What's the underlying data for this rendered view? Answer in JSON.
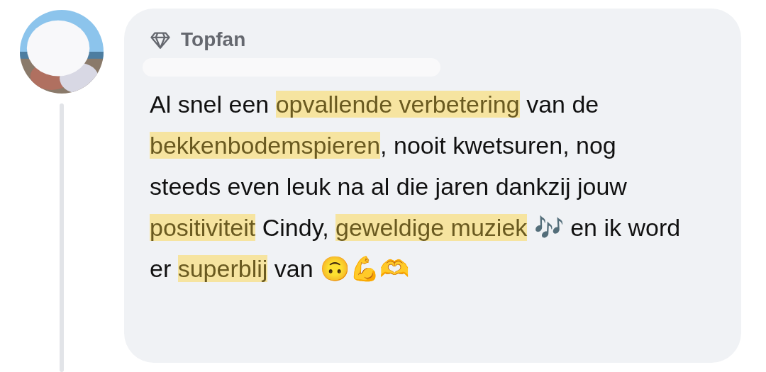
{
  "comment": {
    "badge": "Topfan",
    "segments": [
      {
        "text": "Al snel een ",
        "highlighted": false
      },
      {
        "text": "opvallende verbetering",
        "highlighted": true
      },
      {
        "text": " van de ",
        "highlighted": false
      },
      {
        "text": "bekkenbodemspieren",
        "highlighted": true
      },
      {
        "text": ", nooit kwetsuren, nog steeds even leuk na al die jaren dankzij jouw ",
        "highlighted": false
      },
      {
        "text": "positiviteit",
        "highlighted": true
      },
      {
        "text": " Cindy, ",
        "highlighted": false
      },
      {
        "text": "geweldige muziek",
        "highlighted": true
      },
      {
        "text": " 🎶 en ik word er ",
        "highlighted": false
      },
      {
        "text": "superblij",
        "highlighted": true
      },
      {
        "text": " van 🙃💪🫶",
        "highlighted": false
      }
    ]
  }
}
